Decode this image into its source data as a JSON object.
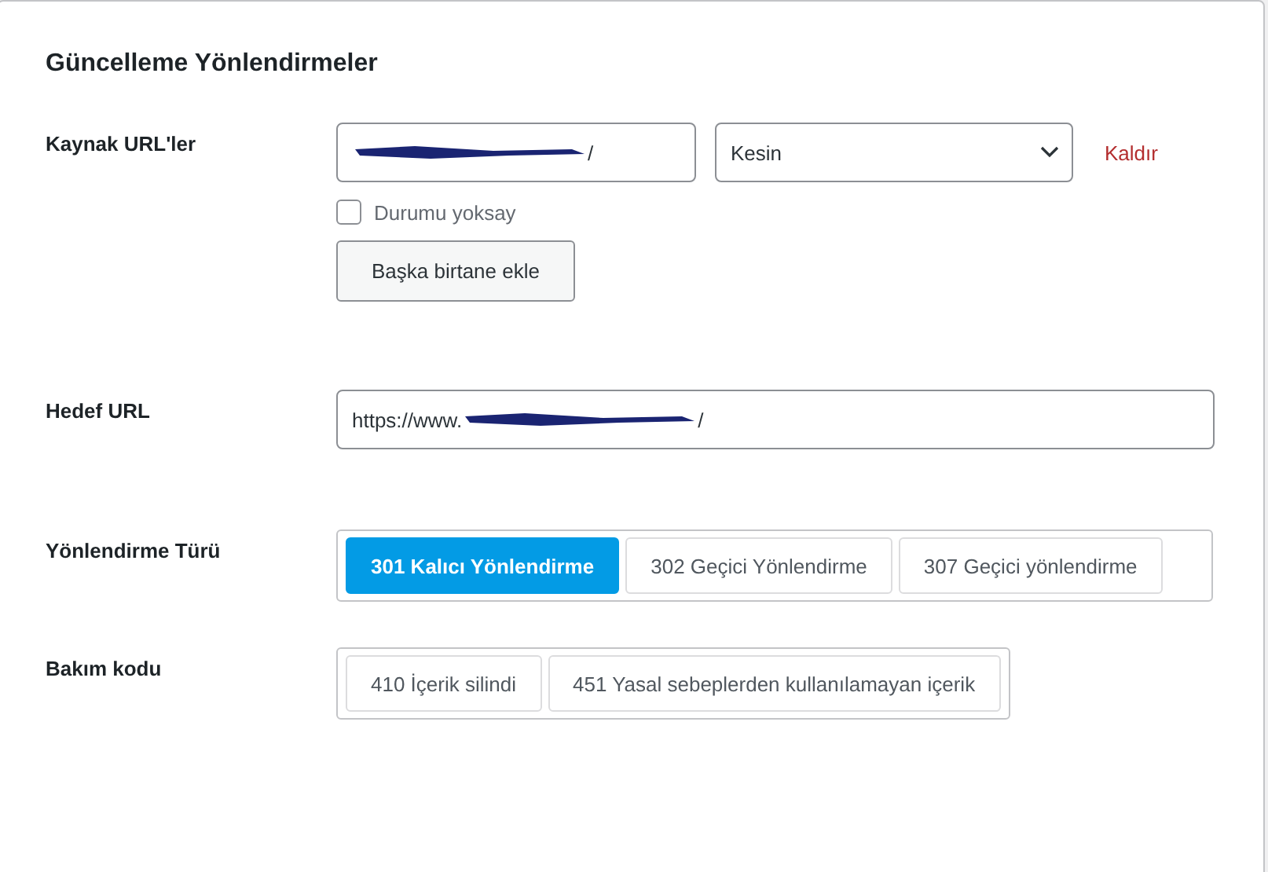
{
  "title": "Güncelleme Yönlendirmeler",
  "source": {
    "label": "Kaynak URL'ler",
    "url": {
      "redacted": true,
      "value_end": "/"
    },
    "match": {
      "value": "Kesin"
    },
    "remove": "Kaldır",
    "ignore_case": {
      "label": "Durumu yoksay",
      "checked": false
    },
    "add_button": "Başka birtane ekle"
  },
  "target": {
    "label": "Hedef URL",
    "url": {
      "value_start": "https://www.",
      "redacted": true,
      "value_end": "/"
    }
  },
  "redirect_type": {
    "label": "Yönlendirme Türü",
    "options": [
      {
        "label": "301 Kalıcı Yönlendirme",
        "selected": true
      },
      {
        "label": "302 Geçici Yönlendirme",
        "selected": false
      },
      {
        "label": "307 Geçici yönlendirme",
        "selected": false
      }
    ]
  },
  "maintenance": {
    "label": "Bakım kodu",
    "options": [
      {
        "label": "410 İçerik silindi",
        "selected": false
      },
      {
        "label": "451 Yasal sebeplerden kullanılamayan içerik",
        "selected": false
      }
    ]
  }
}
